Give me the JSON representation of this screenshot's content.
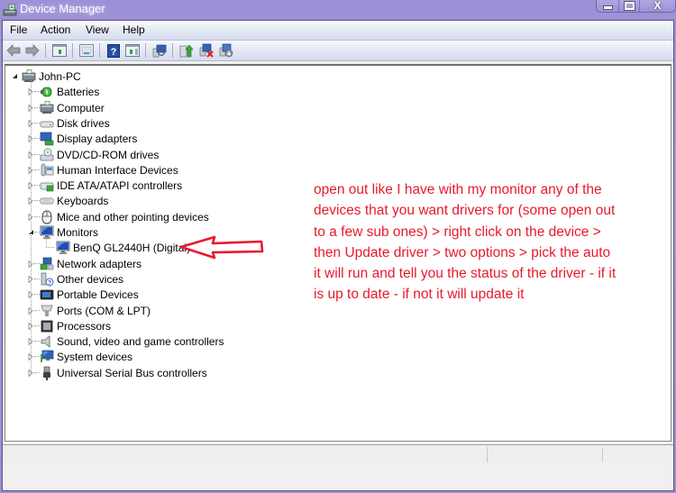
{
  "window": {
    "title": "Device Manager",
    "icon": "device-manager-icon",
    "controls": {
      "minimize": "minimize",
      "maximize": "maximize",
      "close": "X"
    }
  },
  "menu": [
    "File",
    "Action",
    "View",
    "Help"
  ],
  "toolbar": [
    {
      "name": "back",
      "icon": "back-arrow-icon"
    },
    {
      "name": "forward",
      "icon": "forward-arrow-icon"
    },
    {
      "name": "show-hide-console-tree",
      "icon": "console-tree-icon"
    },
    {
      "name": "properties",
      "icon": "properties-icon"
    },
    {
      "name": "help",
      "icon": "help-icon"
    },
    {
      "name": "show-hide-action-pane",
      "icon": "action-pane-icon"
    },
    {
      "name": "scan-hardware-changes",
      "icon": "scan-hardware-icon"
    },
    {
      "name": "update-driver",
      "icon": "update-driver-icon"
    },
    {
      "name": "uninstall",
      "icon": "uninstall-icon"
    },
    {
      "name": "disable",
      "icon": "disable-device-icon"
    }
  ],
  "tree": {
    "root": {
      "label": "John-PC",
      "expanded": true,
      "icon": "computer-icon"
    },
    "categories": [
      {
        "label": "Batteries",
        "icon": "battery-icon",
        "expanded": false
      },
      {
        "label": "Computer",
        "icon": "computer-icon",
        "expanded": false
      },
      {
        "label": "Disk drives",
        "icon": "disk-drive-icon",
        "expanded": false
      },
      {
        "label": "Display adapters",
        "icon": "display-adapter-icon",
        "expanded": false
      },
      {
        "label": "DVD/CD-ROM drives",
        "icon": "dvd-drive-icon",
        "expanded": false
      },
      {
        "label": "Human Interface Devices",
        "icon": "hid-icon",
        "expanded": false
      },
      {
        "label": "IDE ATA/ATAPI controllers",
        "icon": "ide-controller-icon",
        "expanded": false
      },
      {
        "label": "Keyboards",
        "icon": "keyboard-icon",
        "expanded": false
      },
      {
        "label": "Mice and other pointing devices",
        "icon": "mouse-icon",
        "expanded": false
      },
      {
        "label": "Monitors",
        "icon": "monitor-icon",
        "expanded": true,
        "children": [
          "BenQ GL2440H (Digital)"
        ]
      },
      {
        "label": "Network adapters",
        "icon": "network-adapter-icon",
        "expanded": false
      },
      {
        "label": "Other devices",
        "icon": "other-devices-icon",
        "expanded": false
      },
      {
        "label": "Portable Devices",
        "icon": "portable-device-icon",
        "expanded": false
      },
      {
        "label": "Ports (COM & LPT)",
        "icon": "port-icon",
        "expanded": false
      },
      {
        "label": "Processors",
        "icon": "processor-icon",
        "expanded": false
      },
      {
        "label": "Sound, video and game controllers",
        "icon": "sound-icon",
        "expanded": false
      },
      {
        "label": "System devices",
        "icon": "system-devices-icon",
        "expanded": false
      },
      {
        "label": "Universal Serial Bus controllers",
        "icon": "usb-icon",
        "expanded": false
      }
    ]
  },
  "annotation": {
    "text": "open out like I have with my monitor any of the devices that you want drivers for (some open out to a few sub ones) > right click on the device > then Update driver > two options > pick the auto it will run and tell you the status of the driver - if it is up to date - if not it will update it",
    "color": "#e8192c"
  },
  "colors": {
    "titlebar": "#9d90d6",
    "arrow": "#e8192c"
  }
}
